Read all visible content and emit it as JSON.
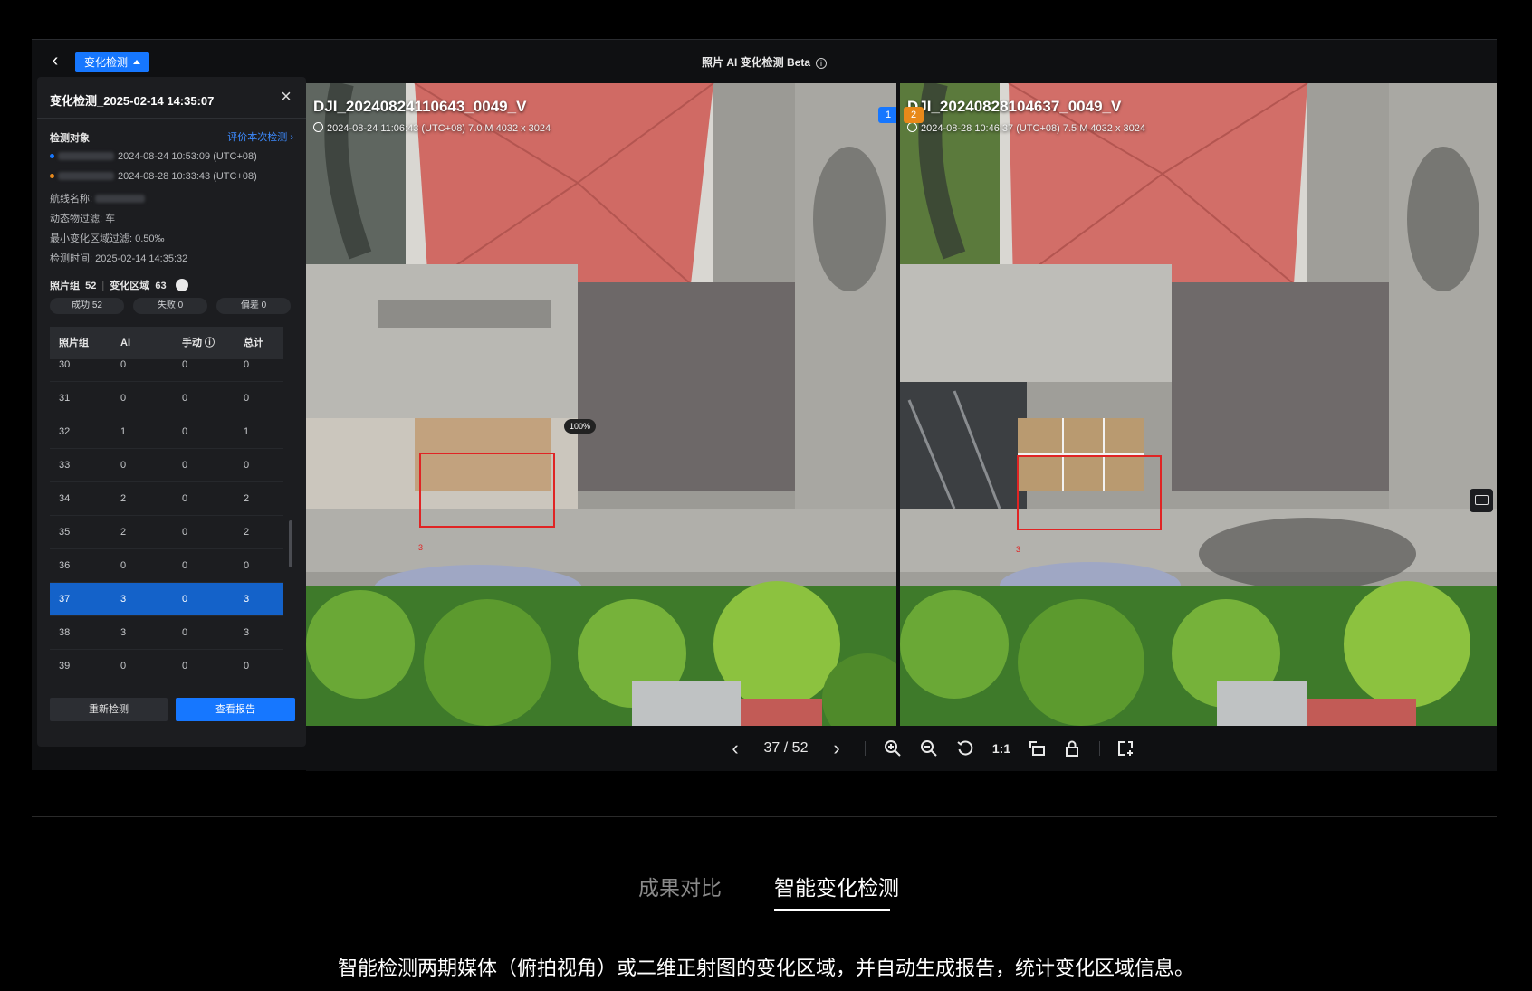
{
  "topbar": {
    "mode_label": "变化检测",
    "title": "照片 AI 变化检测 Beta"
  },
  "panel": {
    "title": "变化检测_2025-02-14 14:35:07",
    "section_title": "检测对象",
    "evaluate_link": "评价本次检测 ›",
    "date1": "2024-08-24 10:53:09 (UTC+08)",
    "date2": "2024-08-28 10:33:43 (UTC+08)",
    "route_label": "航线名称:",
    "dynamic_filter": "动态物过滤:  车",
    "min_change": "最小变化区域过滤:  0.50‰",
    "detect_time": "检测时间:  2025-02-14 14:35:32",
    "photo_group_label": "照片组",
    "photo_group_count": "52",
    "change_area_label": "变化区域",
    "change_area_count": "63",
    "chips": [
      "成功 52",
      "失败 0",
      "偏差 0"
    ],
    "table_headers": [
      "照片组",
      "AI",
      "手动 ⓘ",
      "总计"
    ],
    "rows": [
      [
        "30",
        "0",
        "0",
        "0"
      ],
      [
        "31",
        "0",
        "0",
        "0"
      ],
      [
        "32",
        "1",
        "0",
        "1"
      ],
      [
        "33",
        "0",
        "0",
        "0"
      ],
      [
        "34",
        "2",
        "0",
        "2"
      ],
      [
        "35",
        "2",
        "0",
        "2"
      ],
      [
        "36",
        "0",
        "0",
        "0"
      ],
      [
        "37",
        "3",
        "0",
        "3"
      ],
      [
        "38",
        "3",
        "0",
        "3"
      ],
      [
        "39",
        "0",
        "0",
        "0"
      ]
    ],
    "active_row": "37",
    "redetect_label": "重新检测",
    "report_label": "查看报告"
  },
  "left_photo": {
    "badge": "1",
    "name": "DJI_20240824110643_0049_V",
    "meta": "2024-08-24 11:06:43 (UTC+08)  7.0 M  4032 x 3024",
    "box_number": "3",
    "confidence": "100%"
  },
  "right_photo": {
    "badge": "2",
    "name": "DJI_20240828104637_0049_V",
    "meta": "2024-08-28 10:46:37 (UTC+08)  7.5 M  4032 x 3024",
    "box_number": "3"
  },
  "toolbar": {
    "page_indicator": "37 / 52",
    "one_to_one": "1:1"
  },
  "marketing": {
    "tab_compare": "成果对比",
    "tab_detect": "智能变化检测",
    "description": "智能检测两期媒体（俯拍视角）或二维正射图的变化区域，并自动生成报告，统计变化区域信息。"
  },
  "colors": {
    "accent": "#1677ff",
    "box": "#e02424",
    "badge1": "#1677ff",
    "badge2": "#e8891a"
  }
}
